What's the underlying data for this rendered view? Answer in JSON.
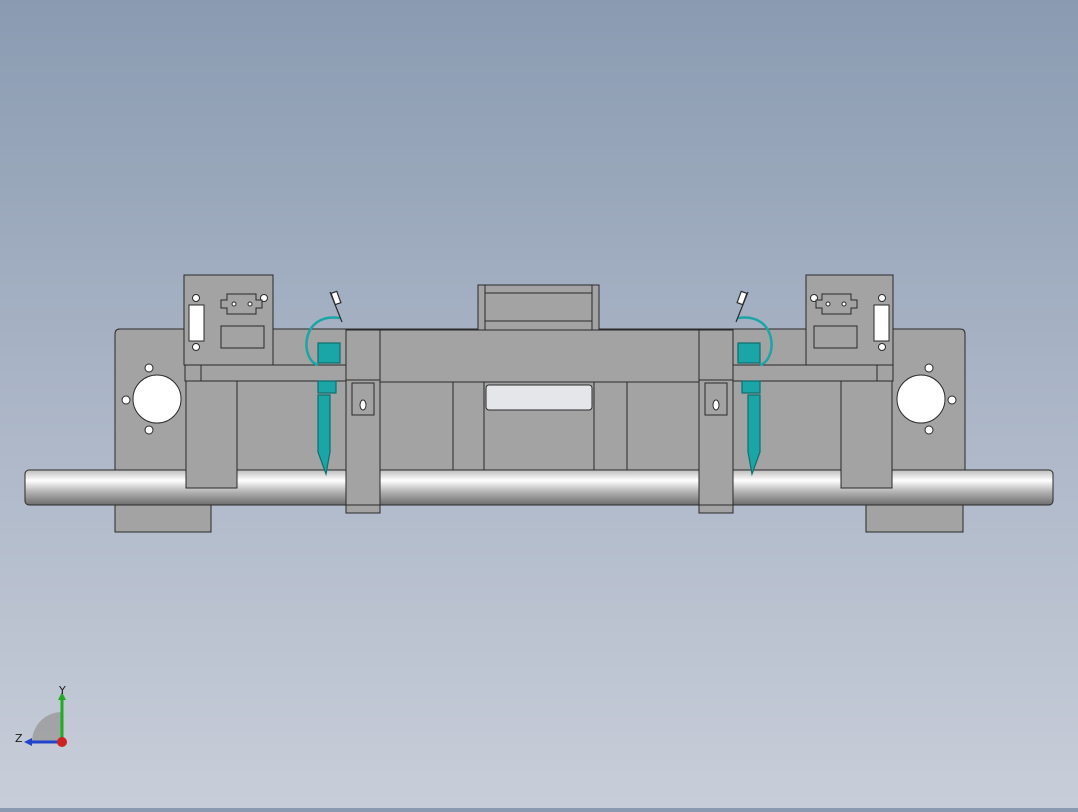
{
  "viewport": {
    "background_top": "#8a9bb1",
    "background_bottom": "#c8ced9",
    "part_fill": "#a3a3a3",
    "edge_color": "#2a2a2a",
    "accent_teal": "#1aa6a6"
  },
  "triad": {
    "y_label": "Y",
    "z_label": "Z",
    "y_axis_color": "#22aa22",
    "z_axis_color": "#2244cc",
    "x_axis_color": "#cc2222"
  }
}
